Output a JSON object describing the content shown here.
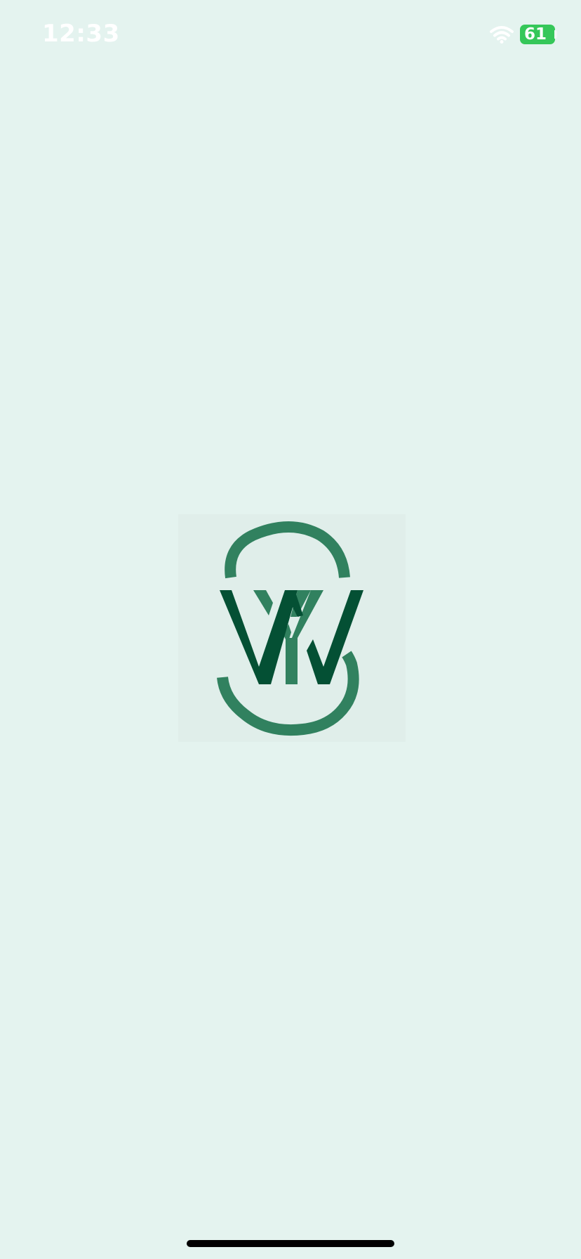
{
  "status_bar": {
    "time": "12:33",
    "battery_level": "61",
    "wifi_icon": "wifi-icon"
  },
  "splash": {
    "logo_icon": "sw-monogram-logo",
    "colors": {
      "background": "#e4f3ef",
      "logo_panel": "#e0eeea",
      "logo_light_green": "#31815f",
      "logo_dark_green": "#045034"
    }
  },
  "home_indicator": {
    "icon": "home-indicator"
  }
}
